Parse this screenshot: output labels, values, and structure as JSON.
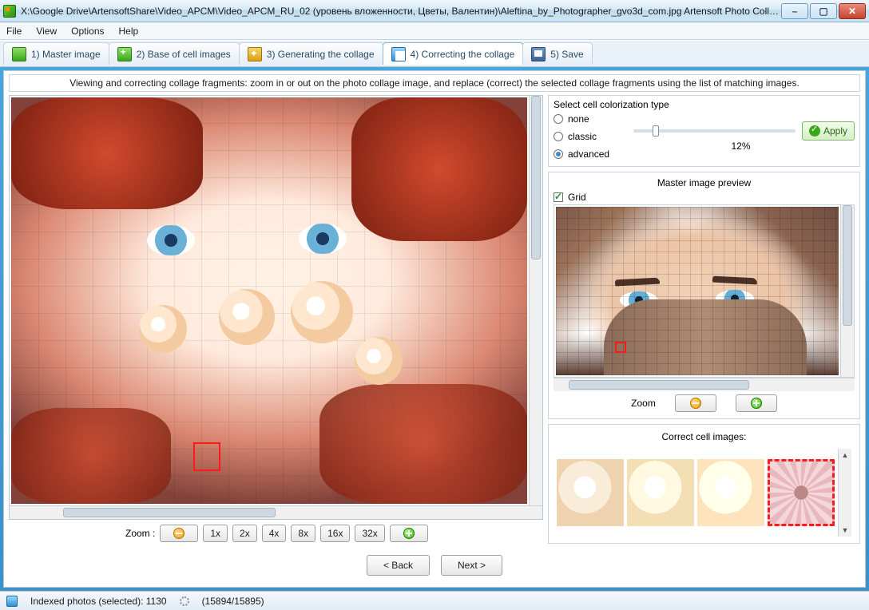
{
  "window": {
    "title": "X:\\Google Drive\\ArtensoftShare\\Video_APCM\\Video_APCM_RU_02 (уровень вложенности, Цветы, Валентин)\\Aleftina_by_Photographer_gvo3d_com.jpg Artensoft Photo Collag..."
  },
  "menu": {
    "file": "File",
    "view": "View",
    "options": "Options",
    "help": "Help"
  },
  "steps": {
    "s1": "1) Master image",
    "s2": "2) Base of cell images",
    "s3": "3) Generating the collage",
    "s4": "4) Correcting the collage",
    "s5": "5) Save"
  },
  "info": "Viewing and correcting collage fragments: zoom in or out on the photo collage image, and replace (correct) the selected collage fragments using the list of matching images.",
  "zoom": {
    "label": "Zoom   :",
    "b1": "1x",
    "b2": "2x",
    "b4": "4x",
    "b8": "8x",
    "b16": "16x",
    "b32": "32x"
  },
  "color": {
    "title": "Select cell colorization type",
    "none": "none",
    "classic": "classic",
    "advanced": "advanced",
    "pct": "12%",
    "apply": "Apply"
  },
  "preview": {
    "title": "Master image preview",
    "grid": "Grid",
    "zoom": "Zoom"
  },
  "cells": {
    "title": "Correct cell images:"
  },
  "nav": {
    "back": "< Back",
    "next": "Next >"
  },
  "status": {
    "indexed": "Indexed photos (selected): 1130",
    "progress": "(15894/15895)"
  }
}
